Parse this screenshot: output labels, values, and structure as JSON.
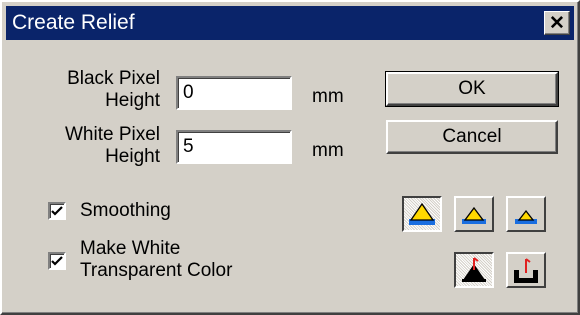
{
  "window": {
    "title": "Create Relief",
    "close_glyph": "✕"
  },
  "black_pixel": {
    "label_line1": "Black Pixel",
    "label_line2": "Height",
    "value": "0",
    "unit": "mm"
  },
  "white_pixel": {
    "label_line1": "White Pixel",
    "label_line2": "Height",
    "value": "5",
    "unit": "mm"
  },
  "buttons": {
    "ok": "OK",
    "cancel": "Cancel"
  },
  "smoothing": {
    "label": "Smoothing",
    "checked": true
  },
  "transparent": {
    "label_line1": "Make White",
    "label_line2": "Transparent Color",
    "checked": true
  },
  "toolbar": {
    "shape_icons": [
      "relief-large-icon",
      "relief-medium-icon",
      "relief-small-icon"
    ],
    "selected_shape": 0,
    "base_icons": [
      "base-up-icon",
      "base-down-icon"
    ],
    "selected_base": 0
  },
  "colors": {
    "titlebar": "#0a246a",
    "dialog_face": "#d4d0c8",
    "icon_yellow": "#ffd800",
    "icon_blue": "#1a6ee0",
    "icon_red": "#e02020"
  }
}
